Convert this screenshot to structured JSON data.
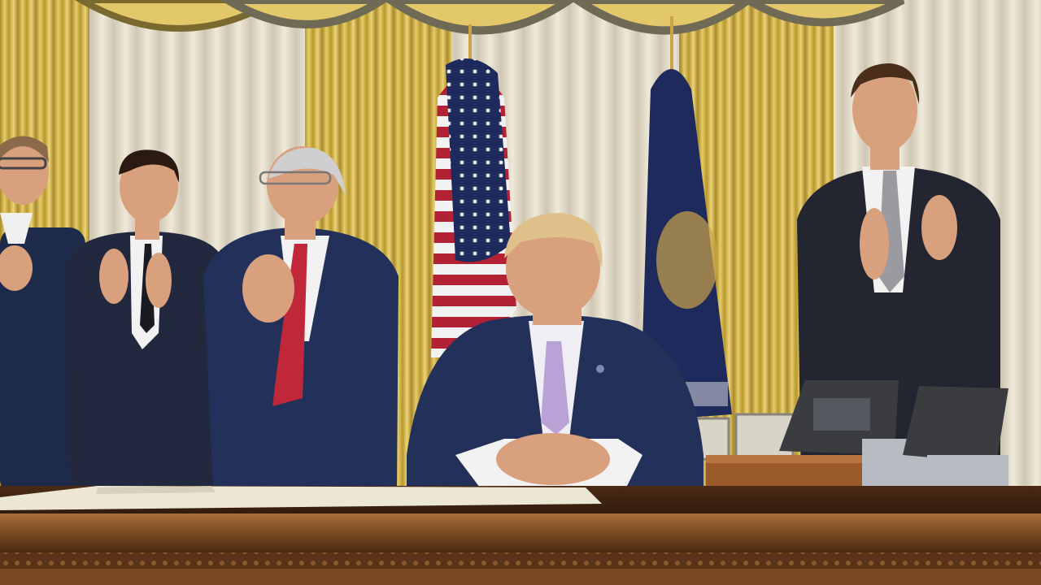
{
  "scene": {
    "kind": "photograph",
    "setting": "office",
    "colors": {
      "curtain_gold": "#d9b94a",
      "curtain_gold_dark": "#a88a2a",
      "curtain_cream": "#e6e0cf",
      "valance": "#8a7a3c",
      "desk_wood": "#6b3f1e",
      "desk_wood_light": "#8a5a2e",
      "navy_suit": "#1e2a4a",
      "charcoal_suit": "#22242c",
      "skin": "#d9a07e",
      "flag_red": "#b22234",
      "flag_blue": "#1f2a5c",
      "flag_white": "#f2f2f2",
      "tie_lavender": "#b9a3d6",
      "tie_red": "#c0283a"
    },
    "people": [
      {
        "id": "person-far-left",
        "pose": "standing-clapping"
      },
      {
        "id": "person-left",
        "pose": "standing-clapping"
      },
      {
        "id": "person-center-left",
        "pose": "standing-clapping",
        "tie": "red"
      },
      {
        "id": "person-seated-center",
        "pose": "seated-hands-folded",
        "tie": "lavender"
      },
      {
        "id": "person-right",
        "pose": "standing-clapping"
      }
    ],
    "props": [
      "us-flag",
      "presidential-flag",
      "desk-phone",
      "desk-phone",
      "wooden-box",
      "document-papers",
      "picture-frames"
    ]
  }
}
